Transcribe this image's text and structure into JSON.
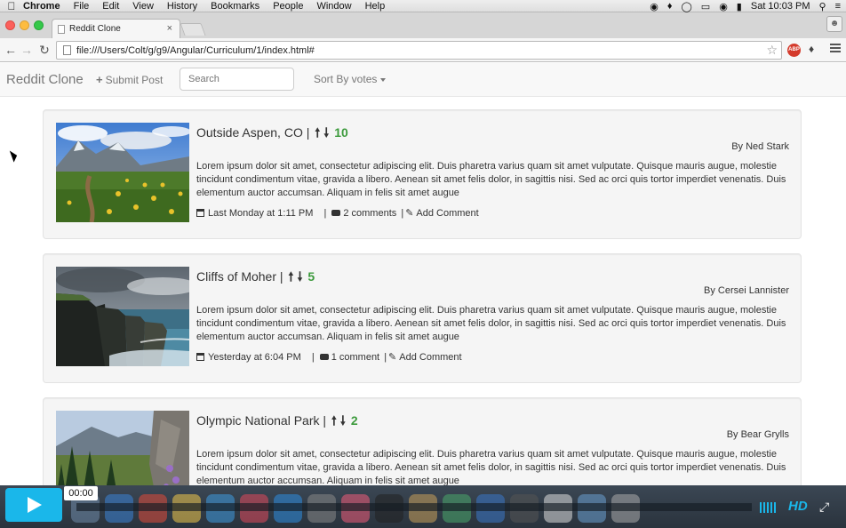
{
  "menubar": {
    "items": [
      "Chrome",
      "File",
      "Edit",
      "View",
      "History",
      "Bookmarks",
      "People",
      "Window",
      "Help"
    ],
    "clock": "Sat 10:03 PM"
  },
  "browser": {
    "tab_title": "Reddit Clone",
    "tab_close": "×",
    "url": "file:///Users/Colt/g/g9/Angular/Curriculum/1/index.html#",
    "abp_label": "ABP"
  },
  "nav": {
    "brand": "Reddit Clone",
    "submit_label": "Submit Post",
    "search_placeholder": "Search",
    "sort_label": "Sort By votes"
  },
  "posts": [
    {
      "title": "Outside Aspen, CO |",
      "votes": "10",
      "author": "By Ned Stark",
      "body": "Lorem ipsum dolor sit amet, consectetur adipiscing elit. Duis pharetra varius quam sit amet vulputate. Quisque mauris augue, molestie tincidunt condimentum vitae, gravida a libero. Aenean sit amet felis dolor, in sagittis nisi. Sed ac orci quis tortor imperdiet venenatis. Duis elementum auctor accumsan. Aliquam in felis sit amet augue",
      "date": "Last Monday at 1:11 PM",
      "comments": "2 comments",
      "add_comment": "Add Comment"
    },
    {
      "title": "Cliffs of Moher |",
      "votes": "5",
      "author": "By Cersei Lannister",
      "body": "Lorem ipsum dolor sit amet, consectetur adipiscing elit. Duis pharetra varius quam sit amet vulputate. Quisque mauris augue, molestie tincidunt condimentum vitae, gravida a libero. Aenean sit amet felis dolor, in sagittis nisi. Sed ac orci quis tortor imperdiet venenatis. Duis elementum auctor accumsan. Aliquam in felis sit amet augue",
      "date": "Yesterday at 6:04 PM",
      "comments": "1 comment",
      "add_comment": "Add Comment"
    },
    {
      "title": "Olympic National Park |",
      "votes": "2",
      "author": "By Bear Grylls",
      "body": "Lorem ipsum dolor sit amet, consectetur adipiscing elit. Duis pharetra varius quam sit amet vulputate. Quisque mauris augue, molestie tincidunt condimentum vitae, gravida a libero. Aenean sit amet felis dolor, in sagittis nisi. Sed ac orci quis tortor imperdiet venenatis. Duis elementum auctor accumsan. Aliquam in felis sit amet augue",
      "date": "",
      "comments": "",
      "add_comment": ""
    }
  ],
  "player": {
    "timecode": "00:00",
    "hd_label": "HD",
    "accent": "#1ab7ea"
  },
  "colors": {
    "vote_green": "#3c9a3c",
    "post_bg": "#f5f5f5",
    "navbar_bg": "#f8f8f8"
  }
}
